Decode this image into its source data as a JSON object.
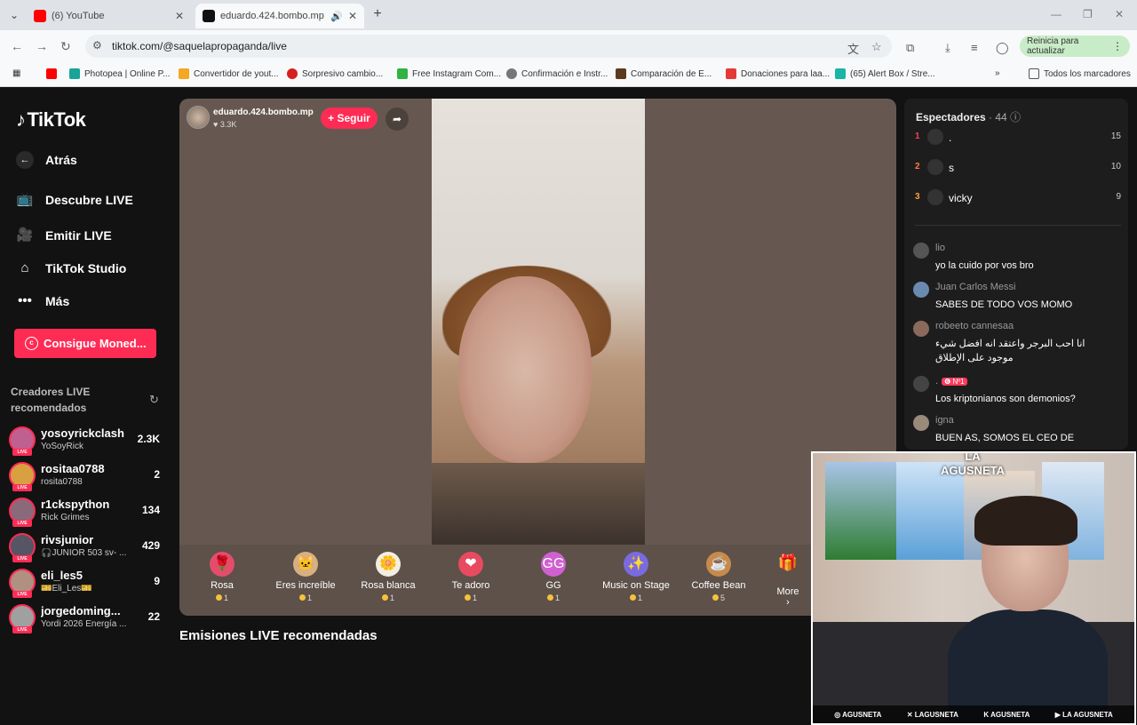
{
  "browser": {
    "tabs": [
      {
        "title": "(6) YouTube",
        "favicon_color": "#ff0000",
        "active": false
      },
      {
        "title": "eduardo.424.bombo.mp (©",
        "favicon_color": "#111111",
        "active": true
      }
    ],
    "url": "tiktok.com/@saquelapropaganda/live",
    "update_label": "Reinicia para actualizar",
    "bookmarks": [
      {
        "label": "",
        "color": "#ff0000"
      },
      {
        "label": "Photopea | Online P...",
        "color": "#18a497"
      },
      {
        "label": "Convertidor de yout...",
        "color": "#f5a623"
      },
      {
        "label": "Sorpresivo cambio...",
        "color": "#d62020"
      },
      {
        "label": "Free Instagram Com...",
        "color": "#2fb344"
      },
      {
        "label": "Confirmación e Instr...",
        "color": "#777777"
      },
      {
        "label": "Comparación de E...",
        "color": "#5a3a20"
      },
      {
        "label": "Donaciones para laa...",
        "color": "#e53935"
      },
      {
        "label": "(65) Alert Box / Stre...",
        "color": "#19b5a5"
      }
    ],
    "all_bookmarks_label": "Todos los marcadores"
  },
  "sidebar": {
    "logo": "TikTok",
    "back": "Atrás",
    "nav": [
      "Descubre LIVE",
      "Emitir LIVE",
      "TikTok Studio",
      "Más"
    ],
    "coins_button": "Consigue Moned...",
    "rec_header": "Creadores LIVE recomendados",
    "creators": [
      {
        "name": "yosoyrickclash",
        "sub": "YoSoyRick",
        "count": "2.3K",
        "color": "#c06090"
      },
      {
        "name": "rositaa0788",
        "sub": "rosita0788",
        "count": "2",
        "color": "#d8a040"
      },
      {
        "name": "r1ckspython",
        "sub": "Rick  Grimes",
        "count": "134",
        "color": "#8a6a7a"
      },
      {
        "name": "rivsjunior",
        "sub": "🎧JUNIOR 503 sv- ...",
        "count": "429",
        "color": "#555566"
      },
      {
        "name": "eli_les5",
        "sub": "🎫Eli_Les🎫",
        "count": "9",
        "color": "#b09080"
      },
      {
        "name": "jorgedoming...",
        "sub": "Yordi 2026 Energía ...",
        "count": "22",
        "color": "#a0a0a0"
      }
    ]
  },
  "live": {
    "host_name": "eduardo.424.bombo.mp",
    "host_likes": "♥ 3.3K",
    "follow_label": "+ Seguir",
    "gifts": [
      {
        "name": "Rosa",
        "price": "1",
        "icon": "🌹"
      },
      {
        "name": "Eres increíble",
        "price": "1",
        "icon": "🐱"
      },
      {
        "name": "Rosa blanca",
        "price": "1",
        "icon": "🌼"
      },
      {
        "name": "Te adoro",
        "price": "1",
        "icon": "❤"
      },
      {
        "name": "GG",
        "price": "1",
        "icon": "GG"
      },
      {
        "name": "Music on Stage",
        "price": "1",
        "icon": "✨"
      },
      {
        "name": "Coffee Bean",
        "price": "5",
        "icon": "☕"
      }
    ],
    "more_label": "More ›"
  },
  "section_title": "Emisiones LIVE recomendadas",
  "viewers": {
    "title": "Espectadores",
    "count": "· 44",
    "top": [
      {
        "rank": "1",
        "name": ".",
        "score": "15",
        "rank_color": "#ff3b5c"
      },
      {
        "rank": "2",
        "name": "s",
        "score": "10",
        "rank_color": "#ff7a3b"
      },
      {
        "rank": "3",
        "name": "vicky",
        "score": "9",
        "rank_color": "#ff9f3b"
      }
    ]
  },
  "comments": [
    {
      "user": "lio",
      "text": "yo la cuido por vos bro",
      "badge": ""
    },
    {
      "user": "Juan Carlos Messi",
      "text": "SABES DE TODO VOS MOMO",
      "badge": ""
    },
    {
      "user": "robeeto cannesaa",
      "text": "انا احب البرجر واعتقد انه افضل شيء موجود على الإطلاق",
      "badge": ""
    },
    {
      "user": ".",
      "text": "Los kriptonianos son demonios?",
      "badge": "❻ Nº1"
    },
    {
      "user": "igna",
      "text": "BUEN   AS, SOMOS EL CEO DE",
      "badge": ""
    }
  ],
  "webcam": {
    "watermark": "LA AGUSNETA",
    "socials": [
      "AGUSNETA",
      "LAGUSNETA",
      "AGUSNETA",
      "LA AGUSNETA"
    ]
  }
}
